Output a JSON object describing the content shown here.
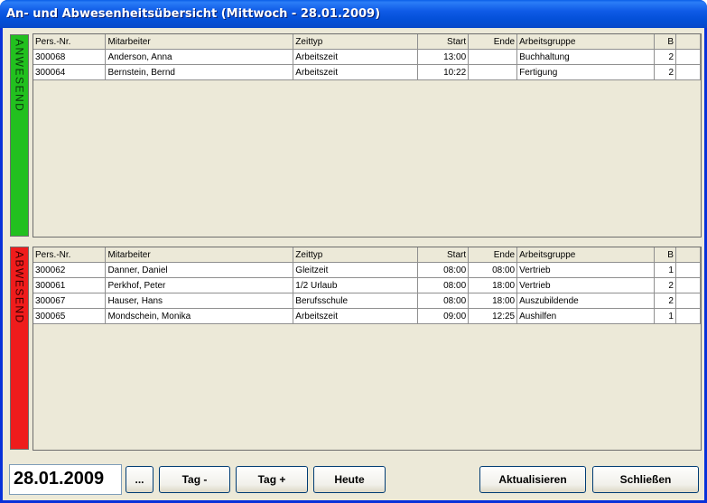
{
  "window": {
    "title": "An- und Abwesenheitsübersicht (Mittwoch - 28.01.2009)"
  },
  "columns": [
    "Pers.-Nr.",
    "Mitarbeiter",
    "Zeittyp",
    "Start",
    "Ende",
    "Arbeitsgruppe",
    "B",
    ""
  ],
  "present": {
    "label": "ANWESEND",
    "color": "#22c01f",
    "rows": [
      {
        "nr": "300068",
        "name": "Anderson, Anna",
        "typ": "Arbeitszeit",
        "start": "13:00",
        "ende": "",
        "gruppe": "Buchhaltung",
        "b": "2"
      },
      {
        "nr": "300064",
        "name": "Bernstein, Bernd",
        "typ": "Arbeitszeit",
        "start": "10:22",
        "ende": "",
        "gruppe": "Fertigung",
        "b": "2"
      }
    ]
  },
  "absent": {
    "label": "ABWESEND",
    "color": "#ef1c1c",
    "rows": [
      {
        "nr": "300062",
        "name": "Danner, Daniel",
        "typ": "Gleitzeit",
        "start": "08:00",
        "ende": "08:00",
        "gruppe": "Vertrieb",
        "b": "1"
      },
      {
        "nr": "300061",
        "name": "Perkhof, Peter",
        "typ": "1/2 Urlaub",
        "start": "08:00",
        "ende": "18:00",
        "gruppe": "Vertrieb",
        "b": "2"
      },
      {
        "nr": "300067",
        "name": "Hauser, Hans",
        "typ": "Berufsschule",
        "start": "08:00",
        "ende": "18:00",
        "gruppe": "Auszubildende",
        "b": "2"
      },
      {
        "nr": "300065",
        "name": "Mondschein, Monika",
        "typ": "Arbeitszeit",
        "start": "09:00",
        "ende": "12:25",
        "gruppe": "Aushilfen",
        "b": "1"
      }
    ]
  },
  "footer": {
    "date": "28.01.2009",
    "picker_label": "...",
    "prev_label": "Tag -",
    "next_label": "Tag +",
    "today_label": "Heute",
    "refresh_label": "Aktualisieren",
    "close_label": "Schließen"
  }
}
